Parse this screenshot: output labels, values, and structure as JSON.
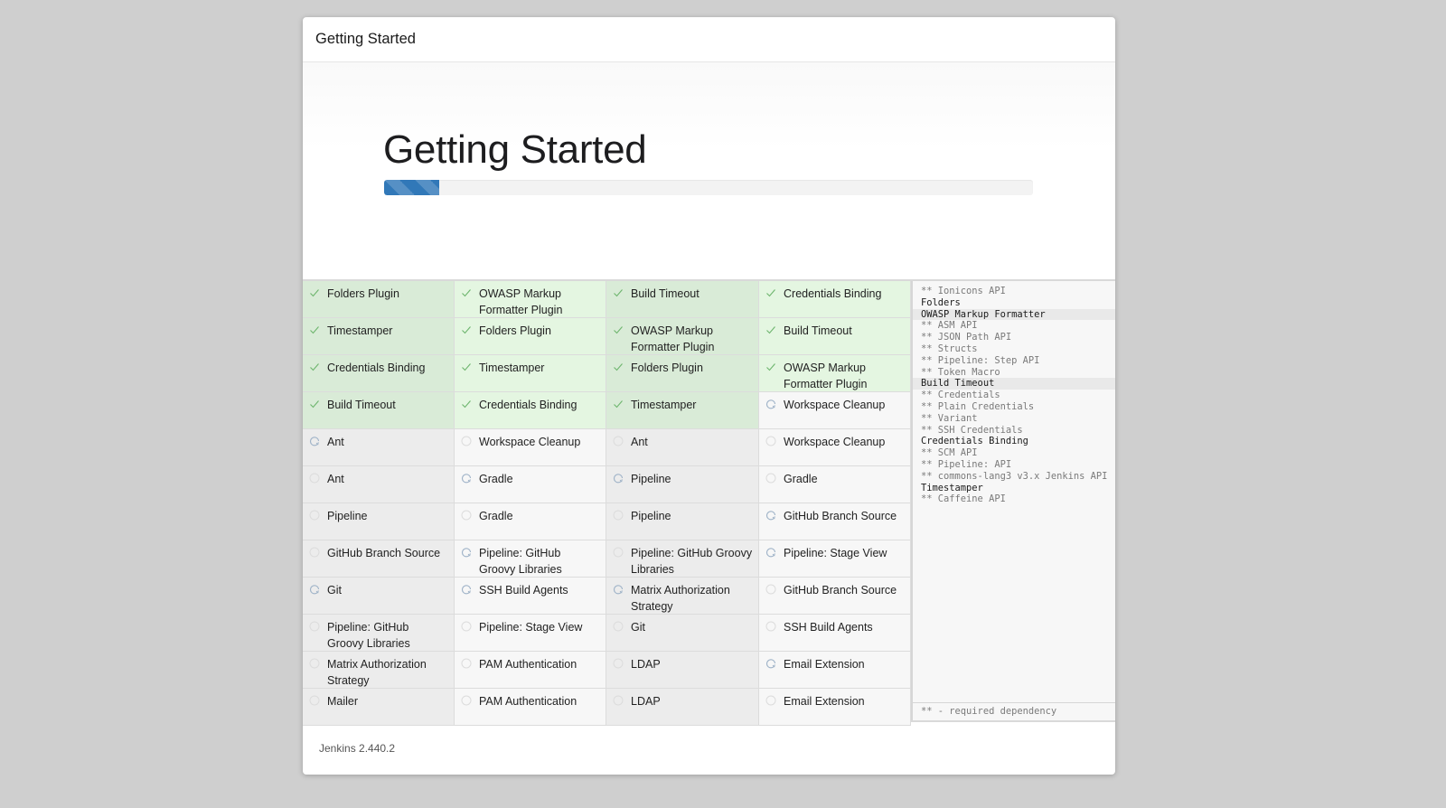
{
  "header": {
    "title": "Getting Started"
  },
  "hero": {
    "title": "Getting Started",
    "progress_percent": 8.5,
    "progress_color": "#3178b8"
  },
  "colors": {
    "success_bg": "#e4f6e1",
    "pending_bg": "#f7f7f7",
    "check_color": "#6db56d",
    "spinner_color": "#9fb3c8"
  },
  "plugins": {
    "columns": 4,
    "items": [
      {
        "label": "Folders Plugin",
        "state": "success"
      },
      {
        "label": "OWASP Markup Formatter Plugin",
        "state": "success"
      },
      {
        "label": "Build Timeout",
        "state": "success"
      },
      {
        "label": "Credentials Binding",
        "state": "success"
      },
      {
        "label": "Timestamper",
        "state": "success"
      },
      {
        "label": "Folders Plugin",
        "state": "success"
      },
      {
        "label": "OWASP Markup Formatter Plugin",
        "state": "success"
      },
      {
        "label": "Build Timeout",
        "state": "success"
      },
      {
        "label": "Credentials Binding",
        "state": "success"
      },
      {
        "label": "Timestamper",
        "state": "success"
      },
      {
        "label": "Folders Plugin",
        "state": "success"
      },
      {
        "label": "OWASP Markup Formatter Plugin",
        "state": "success"
      },
      {
        "label": "Build Timeout",
        "state": "success"
      },
      {
        "label": "Credentials Binding",
        "state": "success"
      },
      {
        "label": "Timestamper",
        "state": "success"
      },
      {
        "label": "Workspace Cleanup",
        "state": "installing"
      },
      {
        "label": "Ant",
        "state": "installing"
      },
      {
        "label": "Workspace Cleanup",
        "state": "pending"
      },
      {
        "label": "Ant",
        "state": "pending"
      },
      {
        "label": "Workspace Cleanup",
        "state": "pending"
      },
      {
        "label": "Ant",
        "state": "pending"
      },
      {
        "label": "Gradle",
        "state": "installing"
      },
      {
        "label": "Pipeline",
        "state": "installing"
      },
      {
        "label": "Gradle",
        "state": "pending"
      },
      {
        "label": "Pipeline",
        "state": "pending"
      },
      {
        "label": "Gradle",
        "state": "pending"
      },
      {
        "label": "Pipeline",
        "state": "pending"
      },
      {
        "label": "GitHub Branch Source",
        "state": "installing"
      },
      {
        "label": "GitHub Branch Source",
        "state": "pending"
      },
      {
        "label": "Pipeline: GitHub Groovy Libraries",
        "state": "installing"
      },
      {
        "label": "Pipeline: GitHub Groovy Libraries",
        "state": "pending"
      },
      {
        "label": "Pipeline: Stage View",
        "state": "installing"
      },
      {
        "label": "Git",
        "state": "installing"
      },
      {
        "label": "SSH Build Agents",
        "state": "installing"
      },
      {
        "label": "Matrix Authorization Strategy",
        "state": "installing"
      },
      {
        "label": "GitHub Branch Source",
        "state": "pending"
      },
      {
        "label": "Pipeline: GitHub Groovy Libraries",
        "state": "pending"
      },
      {
        "label": "Pipeline: Stage View",
        "state": "pending"
      },
      {
        "label": "Git",
        "state": "pending"
      },
      {
        "label": "SSH Build Agents",
        "state": "pending"
      },
      {
        "label": "Matrix Authorization Strategy",
        "state": "pending"
      },
      {
        "label": "PAM Authentication",
        "state": "pending"
      },
      {
        "label": "LDAP",
        "state": "pending"
      },
      {
        "label": "Email Extension",
        "state": "installing"
      },
      {
        "label": "Mailer",
        "state": "pending"
      },
      {
        "label": "PAM Authentication",
        "state": "pending"
      },
      {
        "label": "LDAP",
        "state": "pending"
      },
      {
        "label": "Email Extension",
        "state": "pending"
      }
    ]
  },
  "log": {
    "lines": [
      {
        "text": "** Ionicons API",
        "type": "dep"
      },
      {
        "text": "Folders",
        "type": "plugin"
      },
      {
        "text": "OWASP Markup Formatter",
        "type": "plugin",
        "current": true
      },
      {
        "text": "** ASM API",
        "type": "dep"
      },
      {
        "text": "** JSON Path API",
        "type": "dep"
      },
      {
        "text": "** Structs",
        "type": "dep"
      },
      {
        "text": "** Pipeline: Step API",
        "type": "dep"
      },
      {
        "text": "** Token Macro",
        "type": "dep"
      },
      {
        "text": "Build Timeout",
        "type": "plugin",
        "current": true
      },
      {
        "text": "** Credentials",
        "type": "dep"
      },
      {
        "text": "** Plain Credentials",
        "type": "dep"
      },
      {
        "text": "** Variant",
        "type": "dep"
      },
      {
        "text": "** SSH Credentials",
        "type": "dep"
      },
      {
        "text": "Credentials Binding",
        "type": "plugin"
      },
      {
        "text": "** SCM API",
        "type": "dep"
      },
      {
        "text": "** Pipeline: API",
        "type": "dep"
      },
      {
        "text": "** commons-lang3 v3.x Jenkins API",
        "type": "dep"
      },
      {
        "text": "Timestamper",
        "type": "plugin"
      },
      {
        "text": "** Caffeine API",
        "type": "dep"
      }
    ],
    "legend": "** - required dependency"
  },
  "footer": {
    "version": "Jenkins 2.440.2"
  }
}
